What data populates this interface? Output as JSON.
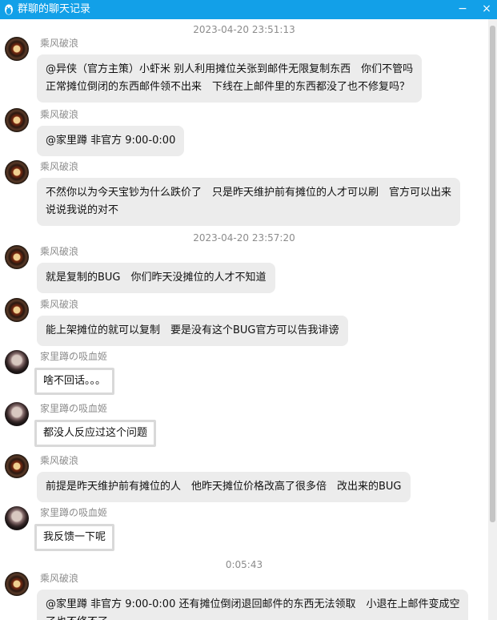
{
  "window": {
    "title": "群聊的聊天记录",
    "minimize_label": "−",
    "close_label": "×"
  },
  "messages": [
    {
      "kind": "timestamp",
      "text": "2023-04-20 23:51:13"
    },
    {
      "kind": "message",
      "sender": "乘风破浪",
      "avatar": "armor-avatar",
      "lines": [
        "@异侠（官方主策）小虾米 别人利用摊位关张到邮件无限复制东西　你们不管吗",
        "正常摊位倒闭的东西邮件领不出来　下线在上邮件里的东西都没了也不修复吗？"
      ]
    },
    {
      "kind": "message",
      "sender": "乘风破浪",
      "avatar": "armor-avatar",
      "lines": [
        "@家里蹲 非官方 9:00-0:00"
      ]
    },
    {
      "kind": "message",
      "sender": "乘风破浪",
      "avatar": "armor-avatar",
      "lines": [
        "不然你以为今天宝钞为什么跌价了　只是昨天维护前有摊位的人才可以刷　官方可以出来",
        "说说我说的对不"
      ]
    },
    {
      "kind": "timestamp",
      "text": "2023-04-20 23:57:20"
    },
    {
      "kind": "message",
      "sender": "乘风破浪",
      "avatar": "armor-avatar",
      "lines": [
        "就是复制的BUG　你们昨天没摊位的人才不知道"
      ]
    },
    {
      "kind": "message",
      "sender": "乘风破浪",
      "avatar": "armor-avatar",
      "lines": [
        "能上架摊位的就可以复制　要是没有这个BUG官方可以告我诽谤"
      ]
    },
    {
      "kind": "message",
      "sender": "家里蹲の吸血姬",
      "avatar": "vampire-avatar",
      "framed": true,
      "lines": [
        "啥不回话。。。"
      ]
    },
    {
      "kind": "message",
      "sender": "家里蹲の吸血姬",
      "avatar": "vampire-avatar",
      "framed": true,
      "lines": [
        "都没人反应过这个问题"
      ]
    },
    {
      "kind": "message",
      "sender": "乘风破浪",
      "avatar": "armor-avatar",
      "lines": [
        "前提是昨天维护前有摊位的人　他昨天摊位价格改高了很多倍　改出来的BUG"
      ]
    },
    {
      "kind": "message",
      "sender": "家里蹲の吸血姬",
      "avatar": "vampire-avatar",
      "framed": true,
      "lines": [
        "我反馈一下呢"
      ]
    },
    {
      "kind": "timestamp",
      "text": "0:05:43"
    },
    {
      "kind": "message",
      "sender": "乘风破浪",
      "avatar": "armor-avatar",
      "lines": [
        "@家里蹲 非官方 9:00-0:00 还有摊位倒闭退回邮件的东西无法领取　小退在上邮件变成空",
        "了也不修不了"
      ]
    }
  ]
}
